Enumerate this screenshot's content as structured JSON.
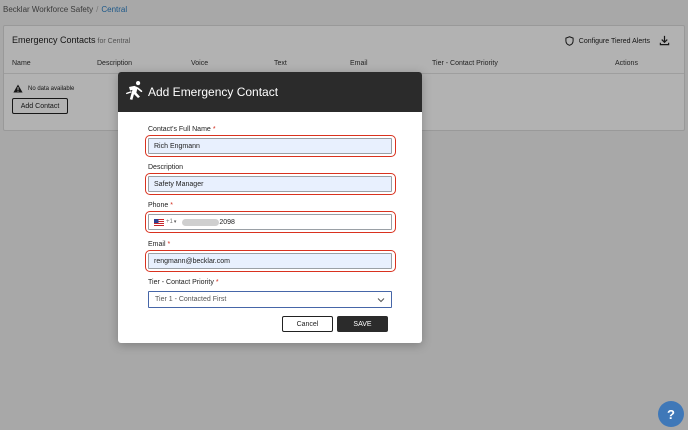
{
  "breadcrumb": {
    "root": "Becklar Workforce Safety",
    "separator": "/",
    "current": "Central"
  },
  "panel": {
    "title": "Emergency Contacts",
    "subtitle": "for Central",
    "tiered_alerts_label": "Configure Tiered Alerts",
    "columns": [
      "Name",
      "Description",
      "Voice",
      "Text",
      "Email",
      "Tier - Contact Priority",
      "Actions"
    ],
    "no_data": "No data available",
    "add_contact_label": "Add Contact"
  },
  "modal": {
    "title": "Add Emergency Contact",
    "fields": {
      "name": {
        "label": "Contact's Full Name",
        "required": "*",
        "value": "Rich Engmann"
      },
      "description": {
        "label": "Description",
        "value": "Safety Manager"
      },
      "phone": {
        "label": "Phone",
        "required": "*",
        "country_code": "+1",
        "caret": "▾",
        "value_suffix": "2098"
      },
      "email": {
        "label": "Email",
        "required": "*",
        "value": "rengmann@becklar.com"
      },
      "tier": {
        "label": "Tier - Contact Priority",
        "required": "*",
        "value": "Tier 1 - Contacted First"
      }
    },
    "cancel_label": "Cancel",
    "save_label": "SAVE"
  },
  "help": {
    "label": "?"
  },
  "colors": {
    "highlight": "#d9321f",
    "header_bg": "#2b2b2b",
    "link": "#2a7fc4",
    "help_bg": "#3f78b8"
  }
}
